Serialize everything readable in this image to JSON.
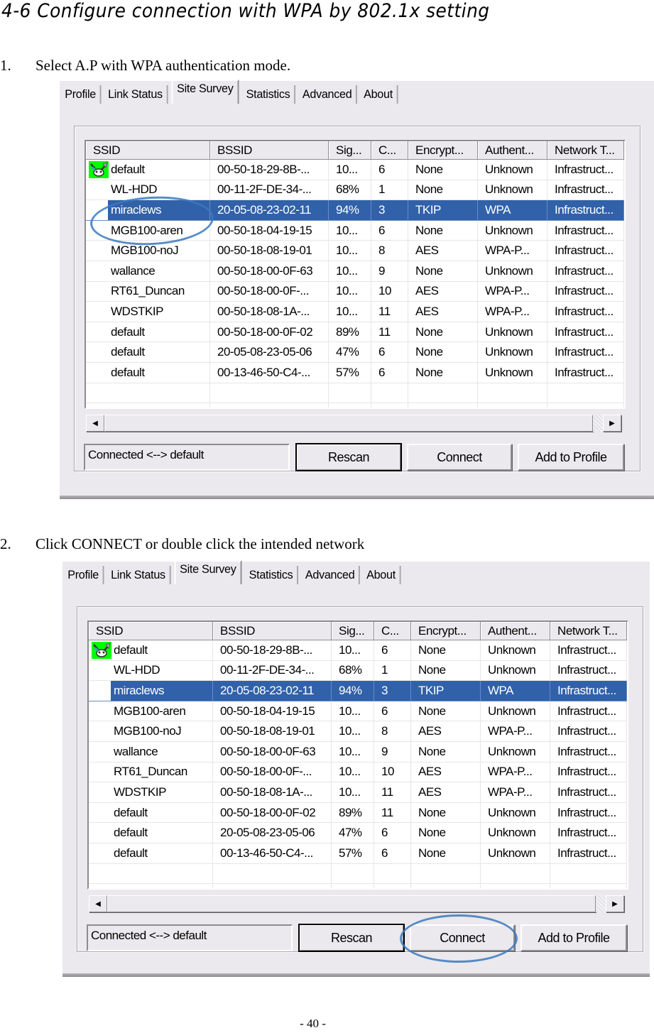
{
  "document": {
    "title": "4-6   Configure connection with WPA by 802.1x setting",
    "page_number": "- 40 -"
  },
  "steps": [
    {
      "number": "1.",
      "text": "Select A.P with WPA authentication mode."
    },
    {
      "number": "2.",
      "text": "Click CONNECT or double click the intended network"
    }
  ],
  "utility": {
    "tabs": [
      "Profile",
      "Link Status",
      "Site Survey",
      "Statistics",
      "Advanced",
      "About"
    ],
    "active_tab": "Site Survey",
    "columns": [
      "SSID",
      "BSSID",
      "Sig...",
      "C...",
      "Encrypt...",
      "Authent...",
      "Network T..."
    ],
    "rows": [
      {
        "ssid": "default",
        "bssid": "00-50-18-29-8B-...",
        "signal": "10...",
        "channel": "6",
        "encryption": "None",
        "auth": "Unknown",
        "network_type": "Infrastruct...",
        "connected_icon": true
      },
      {
        "ssid": "WL-HDD",
        "bssid": "00-11-2F-DE-34-...",
        "signal": "68%",
        "channel": "1",
        "encryption": "None",
        "auth": "Unknown",
        "network_type": "Infrastruct..."
      },
      {
        "ssid": "miraclews",
        "bssid": "20-05-08-23-02-11",
        "signal": "94%",
        "channel": "3",
        "encryption": "TKIP",
        "auth": "WPA",
        "network_type": "Infrastruct...",
        "selected": true
      },
      {
        "ssid": "MGB100-aren",
        "bssid": "00-50-18-04-19-15",
        "signal": "10...",
        "channel": "6",
        "encryption": "None",
        "auth": "Unknown",
        "network_type": "Infrastruct..."
      },
      {
        "ssid": "MGB100-noJ",
        "bssid": "00-50-18-08-19-01",
        "signal": "10...",
        "channel": "8",
        "encryption": "AES",
        "auth": "WPA-P...",
        "network_type": "Infrastruct..."
      },
      {
        "ssid": "wallance",
        "bssid": "00-50-18-00-0F-63",
        "signal": "10...",
        "channel": "9",
        "encryption": "None",
        "auth": "Unknown",
        "network_type": "Infrastruct..."
      },
      {
        "ssid": "RT61_Duncan",
        "bssid": "00-50-18-00-0F-...",
        "signal": "10...",
        "channel": "10",
        "encryption": "AES",
        "auth": "WPA-P...",
        "network_type": "Infrastruct..."
      },
      {
        "ssid": "WDSTKIP",
        "bssid": "00-50-18-08-1A-...",
        "signal": "10...",
        "channel": "11",
        "encryption": "AES",
        "auth": "WPA-P...",
        "network_type": "Infrastruct..."
      },
      {
        "ssid": "default",
        "bssid": "00-50-18-00-0F-02",
        "signal": "89%",
        "channel": "11",
        "encryption": "None",
        "auth": "Unknown",
        "network_type": "Infrastruct..."
      },
      {
        "ssid": "default",
        "bssid": "20-05-08-23-05-06",
        "signal": "47%",
        "channel": "6",
        "encryption": "None",
        "auth": "Unknown",
        "network_type": "Infrastruct..."
      },
      {
        "ssid": "default",
        "bssid": "00-13-46-50-C4-...",
        "signal": "57%",
        "channel": "6",
        "encryption": "None",
        "auth": "Unknown",
        "network_type": "Infrastruct..."
      }
    ],
    "status_text": "Connected <--> default",
    "buttons": {
      "rescan": "Rescan",
      "connect": "Connect",
      "add_to_profile": "Add to Profile"
    },
    "icons": {
      "connected": "connected-network-icon",
      "scroll_left": "scroll-left-arrow-icon",
      "scroll_right": "scroll-right-arrow-icon"
    },
    "colors": {
      "selection": "#3161a9",
      "annotation": "#3b79bd",
      "connected_icon_bg": "#00ff00"
    }
  },
  "annotations": {
    "screenshot_1": "circle-around-miraclews-row",
    "screenshot_2": "circle-around-connect-button"
  }
}
